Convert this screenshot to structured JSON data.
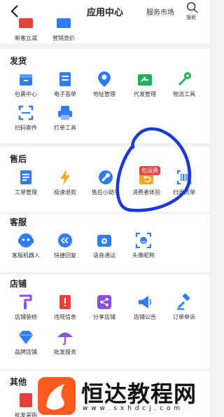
{
  "header": {
    "title": "应用中心",
    "market_label": "服务市场",
    "search_label": "搜索"
  },
  "top_row": [
    {
      "label": "新客立减",
      "icon": "coupon-icon"
    },
    {
      "label": "营销竞价",
      "icon": "bid-icon"
    }
  ],
  "sections": {
    "shipping": {
      "title": "发货",
      "items": [
        {
          "label": "包裹中心",
          "icon": "package-icon"
        },
        {
          "label": "电子面单",
          "icon": "waybill-icon"
        },
        {
          "label": "地址管理",
          "icon": "location-icon"
        },
        {
          "label": "代发管理",
          "icon": "forward-icon"
        },
        {
          "label": "物流工具",
          "icon": "logistics-tool-icon"
        },
        {
          "label": "扫码寄件",
          "icon": "scan-icon"
        },
        {
          "label": "打单工具",
          "icon": "printer-icon"
        }
      ]
    },
    "aftersale": {
      "title": "售后",
      "badge": "包运费",
      "items": [
        {
          "label": "工单管理",
          "icon": "ticket-icon"
        },
        {
          "label": "极速退款",
          "icon": "lightning-icon"
        },
        {
          "label": "售后小助手",
          "icon": "wrench-icon"
        },
        {
          "label": "消费者体验",
          "icon": "return-box-icon"
        },
        {
          "label": "扫退货单",
          "icon": "barcode-icon"
        }
      ]
    },
    "service": {
      "title": "客服",
      "items": [
        {
          "label": "客服机器人",
          "icon": "robot-icon"
        },
        {
          "label": "快捷回复",
          "icon": "quick-reply-icon"
        },
        {
          "label": "语音通话",
          "icon": "phone-icon"
        },
        {
          "label": "头像昵称",
          "icon": "avatar-icon"
        }
      ]
    },
    "store": {
      "title": "店铺",
      "items": [
        {
          "label": "店铺装修",
          "icon": "decorate-icon"
        },
        {
          "label": "违规信息",
          "icon": "warning-icon"
        },
        {
          "label": "分享店铺",
          "icon": "share-icon"
        },
        {
          "label": "店铺公告",
          "icon": "megaphone-icon"
        },
        {
          "label": "订单申诉",
          "icon": "gavel-icon"
        },
        {
          "label": "品牌店铺",
          "icon": "diamond-icon"
        },
        {
          "label": "批发服务",
          "icon": "umbrella-icon"
        }
      ]
    },
    "other": {
      "title": "其他",
      "items": [
        {
          "label": "批发采购",
          "icon": "purchase-icon"
        }
      ]
    }
  },
  "watermark": {
    "text": "恒达教程网",
    "url": "w w w . s x h d c j . c o m"
  },
  "colors": {
    "blue": "#2e7cf6",
    "green": "#19b35a",
    "red": "#e8403a",
    "orange": "#f6a623",
    "purple": "#8b4fe0",
    "annotation": "#1a3ad8"
  }
}
